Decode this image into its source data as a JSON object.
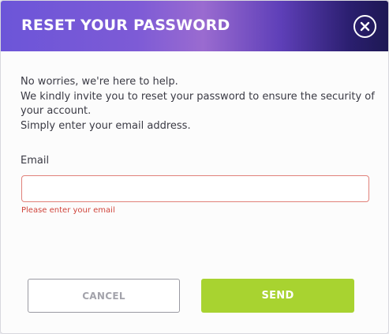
{
  "dialog": {
    "title": "RESET YOUR PASSWORD",
    "close_icon": "close-icon"
  },
  "intro": {
    "line1": "No worries, we're here to help.",
    "line2": "We kindly invite you to reset your password to ensure the security of your account.",
    "line3": "Simply enter your email address."
  },
  "email": {
    "label": "Email",
    "value": "",
    "placeholder": "",
    "error": "Please enter your email"
  },
  "actions": {
    "cancel_label": "CANCEL",
    "send_label": "SEND"
  },
  "colors": {
    "accent_green": "#a8d330",
    "error_red": "#d0453c",
    "header_start": "#6c55d8",
    "header_end": "#1d1852"
  }
}
